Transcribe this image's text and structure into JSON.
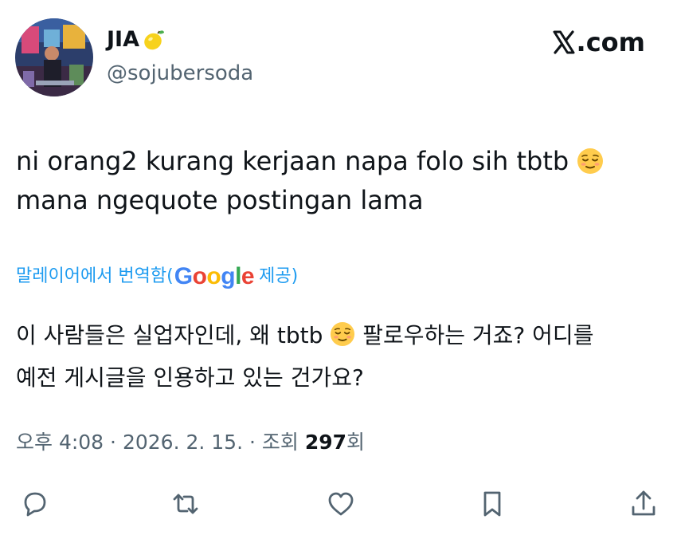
{
  "author": {
    "display_name": "JIA",
    "name_emoji": "lemon-icon",
    "handle": "@sojubersoda",
    "avatar": "avatar-photo"
  },
  "brand": {
    "label": ".com",
    "logo": "x-logo-icon"
  },
  "tweet": {
    "line1": "ni orang2 kurang kerjaan napa folo sih tbtb",
    "line1_emoji": "relieved-face-emoji",
    "line2": "mana ngequote postingan lama"
  },
  "translation": {
    "prefix": "말레이어에서 번역함(",
    "google_letters": [
      "G",
      "o",
      "o",
      "g",
      "l",
      "e"
    ],
    "suffix": "제공)",
    "line1_before": "이 사람들은 실업자인데, 왜 tbtb",
    "line1_after": "팔로우하는 거죠? 어디를",
    "line2": "예전 게시글을 인용하고 있는 건가요?"
  },
  "meta": {
    "time": "오후 4:08",
    "separator": "·",
    "date": "2026. 2. 15.",
    "views_label": "조회",
    "views_count": "297",
    "views_suffix": "회"
  },
  "actions": [
    "reply-icon",
    "repost-icon",
    "like-icon",
    "bookmark-icon",
    "share-icon"
  ],
  "colors": {
    "text": "#0f1419",
    "secondary": "#536471",
    "link": "#1d9bf0"
  }
}
